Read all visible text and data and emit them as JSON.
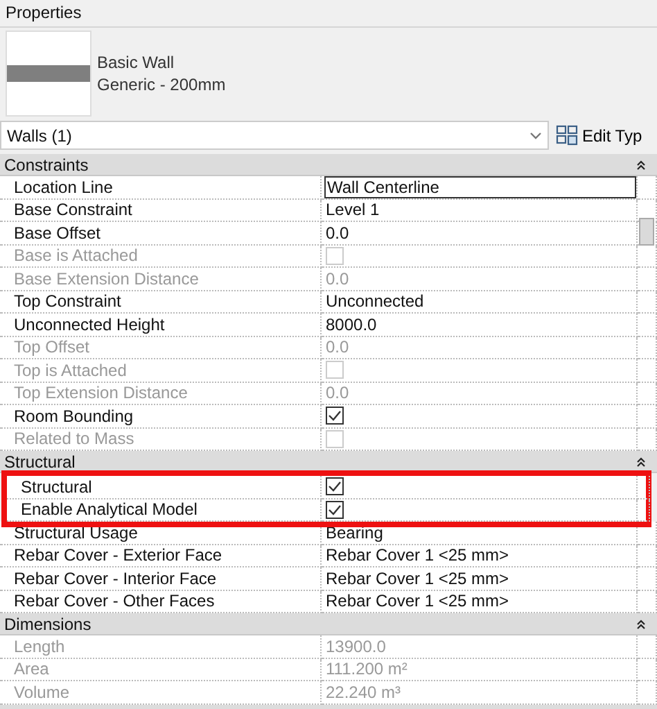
{
  "panel": {
    "title": "Properties"
  },
  "type_selector": {
    "family": "Basic Wall",
    "type": "Generic - 200mm"
  },
  "instance_filter": {
    "value": "Walls (1)"
  },
  "edit_type_button": {
    "label": "Edit Typ"
  },
  "sections": [
    {
      "title": "Constraints",
      "expanded": true,
      "rows": [
        {
          "name": "Location Line",
          "kind": "field",
          "value": "Wall Centerline",
          "disabled": false,
          "highlighted": false
        },
        {
          "name": "Base Constraint",
          "kind": "text",
          "value": "Level 1",
          "disabled": false,
          "highlighted": false
        },
        {
          "name": "Base Offset",
          "kind": "text",
          "value": "0.0",
          "disabled": false,
          "highlighted": false
        },
        {
          "name": "Base is Attached",
          "kind": "checkbox",
          "checked": false,
          "disabled": true,
          "highlighted": false
        },
        {
          "name": "Base Extension Distance",
          "kind": "text",
          "value": "0.0",
          "disabled": true,
          "highlighted": false
        },
        {
          "name": "Top Constraint",
          "kind": "text",
          "value": "Unconnected",
          "disabled": false,
          "highlighted": false
        },
        {
          "name": "Unconnected Height",
          "kind": "text",
          "value": "8000.0",
          "disabled": false,
          "highlighted": false
        },
        {
          "name": "Top Offset",
          "kind": "text",
          "value": "0.0",
          "disabled": true,
          "highlighted": false
        },
        {
          "name": "Top is Attached",
          "kind": "checkbox",
          "checked": false,
          "disabled": true,
          "highlighted": false
        },
        {
          "name": "Top Extension Distance",
          "kind": "text",
          "value": "0.0",
          "disabled": true,
          "highlighted": false
        },
        {
          "name": "Room Bounding",
          "kind": "checkbox",
          "checked": true,
          "disabled": false,
          "highlighted": false
        },
        {
          "name": "Related to Mass",
          "kind": "checkbox",
          "checked": false,
          "disabled": true,
          "highlighted": false
        }
      ]
    },
    {
      "title": "Structural",
      "expanded": true,
      "rows": [
        {
          "name": "Structural",
          "kind": "checkbox",
          "checked": true,
          "disabled": false,
          "highlighted": true
        },
        {
          "name": "Enable Analytical Model",
          "kind": "checkbox",
          "checked": true,
          "disabled": false,
          "highlighted": true
        },
        {
          "name": "Structural Usage",
          "kind": "text",
          "value": "Bearing",
          "disabled": false,
          "highlighted": false
        },
        {
          "name": "Rebar Cover - Exterior Face",
          "kind": "text",
          "value": "Rebar Cover 1 <25 mm>",
          "disabled": false,
          "highlighted": false
        },
        {
          "name": "Rebar Cover - Interior Face",
          "kind": "text",
          "value": "Rebar Cover 1 <25 mm>",
          "disabled": false,
          "highlighted": false
        },
        {
          "name": "Rebar Cover - Other Faces",
          "kind": "text",
          "value": "Rebar Cover 1 <25 mm>",
          "disabled": false,
          "highlighted": false
        }
      ]
    },
    {
      "title": "Dimensions",
      "expanded": true,
      "rows": [
        {
          "name": "Length",
          "kind": "text",
          "value": "13900.0",
          "disabled": true,
          "highlighted": false
        },
        {
          "name": "Area",
          "kind": "text",
          "value": "111.200 m²",
          "disabled": true,
          "highlighted": false
        },
        {
          "name": "Volume",
          "kind": "text",
          "value": "22.240 m³",
          "disabled": true,
          "highlighted": false
        }
      ]
    }
  ]
}
